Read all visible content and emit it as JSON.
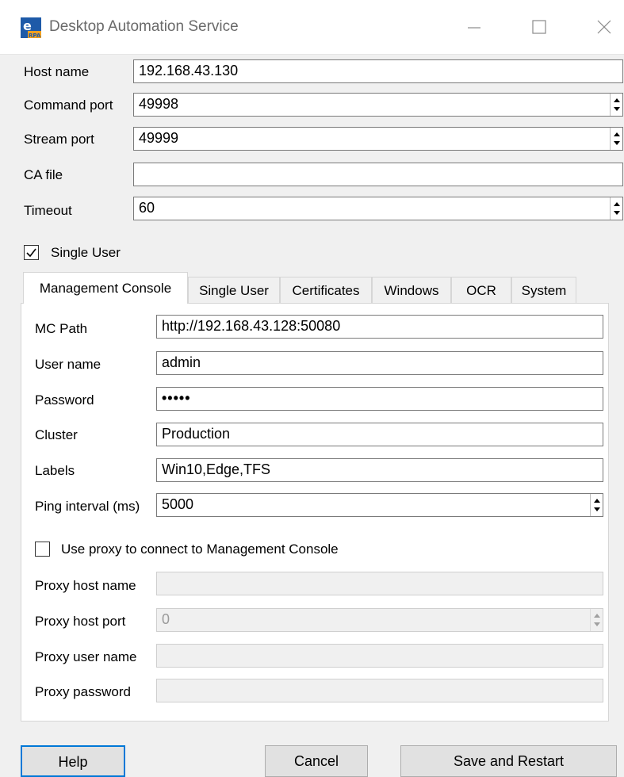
{
  "window": {
    "title": "Desktop Automation Service",
    "icon": "app-eye-rpa-icon",
    "controls": [
      "minimize-icon",
      "maximize-icon",
      "close-icon"
    ]
  },
  "service": {
    "host_name": {
      "label": "Host name",
      "value": "192.168.43.130"
    },
    "command_port": {
      "label": "Command port",
      "value": "49998"
    },
    "stream_port": {
      "label": "Stream port",
      "value": "49999"
    },
    "ca_file": {
      "label": "CA file",
      "value": ""
    },
    "timeout": {
      "label": "Timeout",
      "value": "60"
    },
    "single_user": {
      "label": "Single User",
      "checked": true
    }
  },
  "tabs": [
    {
      "label": "Management Console",
      "active": true
    },
    {
      "label": "Single User",
      "active": false
    },
    {
      "label": "Certificates",
      "active": false
    },
    {
      "label": "Windows",
      "active": false
    },
    {
      "label": "OCR",
      "active": false
    },
    {
      "label": "System",
      "active": false
    }
  ],
  "management_console": {
    "mc_path": {
      "label": "MC Path",
      "value": "http://192.168.43.128:50080"
    },
    "user_name": {
      "label": "User name",
      "value": "admin"
    },
    "password": {
      "label": "Password",
      "value": "•••••"
    },
    "cluster": {
      "label": "Cluster",
      "value": "Production"
    },
    "labels": {
      "label": "Labels",
      "value": "Win10,Edge,TFS"
    },
    "ping_interval": {
      "label": "Ping interval (ms)",
      "value": "5000"
    },
    "use_proxy": {
      "label": "Use proxy to connect to Management Console",
      "checked": false
    },
    "proxy_host_name": {
      "label": "Proxy host name",
      "value": ""
    },
    "proxy_host_port": {
      "label": "Proxy host port",
      "value": "0"
    },
    "proxy_user_name": {
      "label": "Proxy user name",
      "value": ""
    },
    "proxy_password": {
      "label": "Proxy password",
      "value": ""
    }
  },
  "buttons": {
    "help": "Help",
    "cancel": "Cancel",
    "save_restart": "Save and Restart"
  },
  "colors": {
    "accent": "#0078d7",
    "icon_blue": "#1e5aa8",
    "icon_orange": "#f0a020"
  }
}
